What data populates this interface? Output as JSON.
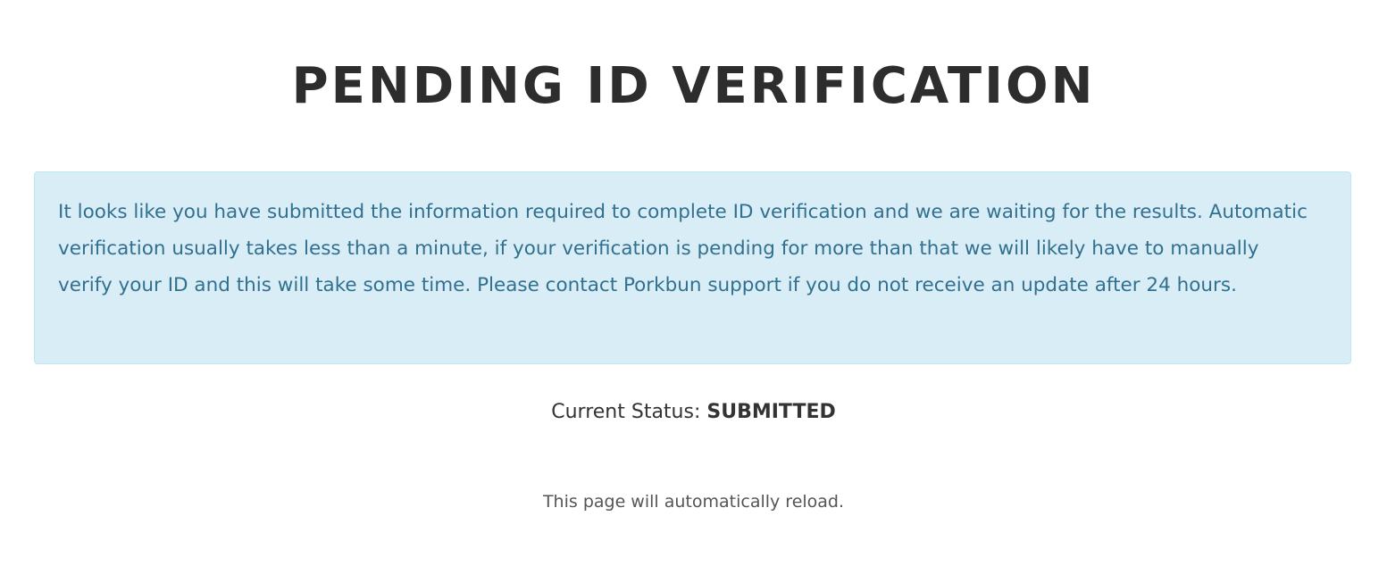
{
  "page": {
    "title": "PENDING ID VERIFICATION",
    "alert_message": "It looks like you have submitted the information required to complete ID verification and we are waiting for the results. Automatic verification usually takes less than a minute, if your verification is pending for more than that we will likely have to manually verify your ID and this will take some time. Please contact Porkbun support if you do not receive an update after 24 hours.",
    "status_label": "Current Status: ",
    "status_value": "SUBMITTED",
    "reload_note": "This page will automatically reload."
  },
  "colors": {
    "alert_bg": "#d9edf7",
    "alert_border": "#bce8f1",
    "alert_text": "#31708f"
  }
}
